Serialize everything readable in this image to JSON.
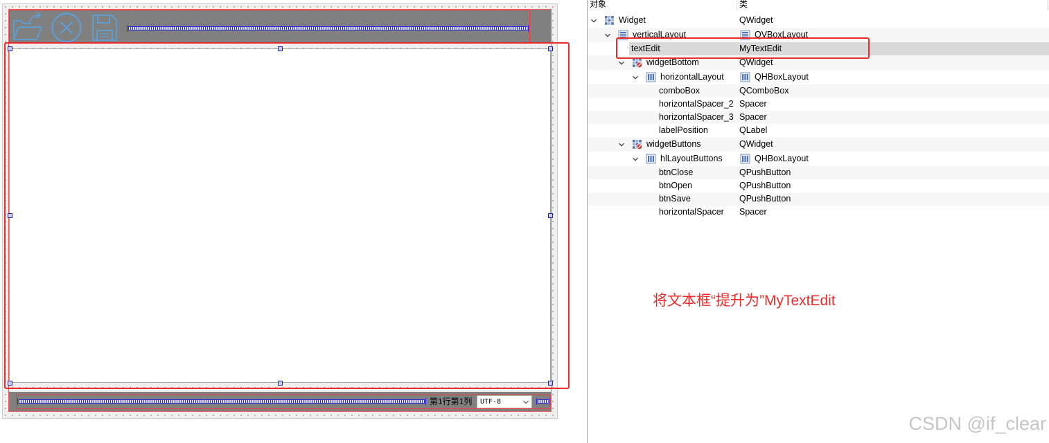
{
  "form_preview": {
    "toolbar": {
      "buttons": [
        {
          "icon": "folder-open-icon"
        },
        {
          "icon": "close-circle-icon"
        },
        {
          "icon": "floppy-disk-icon"
        }
      ]
    },
    "status_bar": {
      "position_label": "第1行第1列",
      "encoding_combo": {
        "selected": "UTF-8",
        "icon": "chevron-down-icon"
      }
    }
  },
  "inspector": {
    "headers": {
      "object": "对象",
      "class": "类"
    },
    "tree": [
      {
        "name": "Widget",
        "class": "QWidget",
        "icon": "widget-grid-icon",
        "expanded": true,
        "children": [
          {
            "name": "verticalLayout",
            "class": "QVBoxLayout",
            "icon": "vertical-layout-icon",
            "class_icon": "vertical-layout-icon",
            "expanded": true,
            "children": [
              {
                "name": "textEdit",
                "class": "MyTextEdit",
                "selected": true
              },
              {
                "name": "widgetBottom",
                "class": "QWidget",
                "icon": "widget-no-layout-icon",
                "expanded": true,
                "children": [
                  {
                    "name": "horizontalLayout",
                    "class": "QHBoxLayout",
                    "icon": "horizontal-layout-icon",
                    "class_icon": "horizontal-layout-icon",
                    "expanded": true,
                    "children": [
                      {
                        "name": "comboBox",
                        "class": "QComboBox"
                      },
                      {
                        "name": "horizontalSpacer_2",
                        "class": "Spacer"
                      },
                      {
                        "name": "horizontalSpacer_3",
                        "class": "Spacer"
                      },
                      {
                        "name": "labelPosition",
                        "class": "QLabel"
                      }
                    ]
                  }
                ]
              },
              {
                "name": "widgetButtons",
                "class": "QWidget",
                "icon": "widget-no-layout-icon",
                "expanded": true,
                "children": [
                  {
                    "name": "hlLayoutButtons",
                    "class": "QHBoxLayout",
                    "icon": "horizontal-layout-icon",
                    "class_icon": "horizontal-layout-icon",
                    "expanded": true,
                    "children": [
                      {
                        "name": "btnClose",
                        "class": "QPushButton"
                      },
                      {
                        "name": "btnOpen",
                        "class": "QPushButton"
                      },
                      {
                        "name": "btnSave",
                        "class": "QPushButton"
                      },
                      {
                        "name": "horizontalSpacer",
                        "class": "Spacer"
                      }
                    ]
                  }
                ]
              }
            ]
          }
        ]
      }
    ]
  },
  "annotation": {
    "text": "将文本框“提升为”MyTextEdit"
  },
  "watermark": "CSDN @if_clear",
  "colors": {
    "annotation_red": "#ee2a2a",
    "layout_outline_red": "#f03c3c",
    "selection_bg": "#d9d9d9",
    "alternate_row_bg": "#f7f7f7",
    "container_gray": "#808080",
    "spacer_blue": "#2626d8",
    "toolbar_icon_blue": "#5aa3e3",
    "watermark_gray": "#c6c6c6"
  }
}
